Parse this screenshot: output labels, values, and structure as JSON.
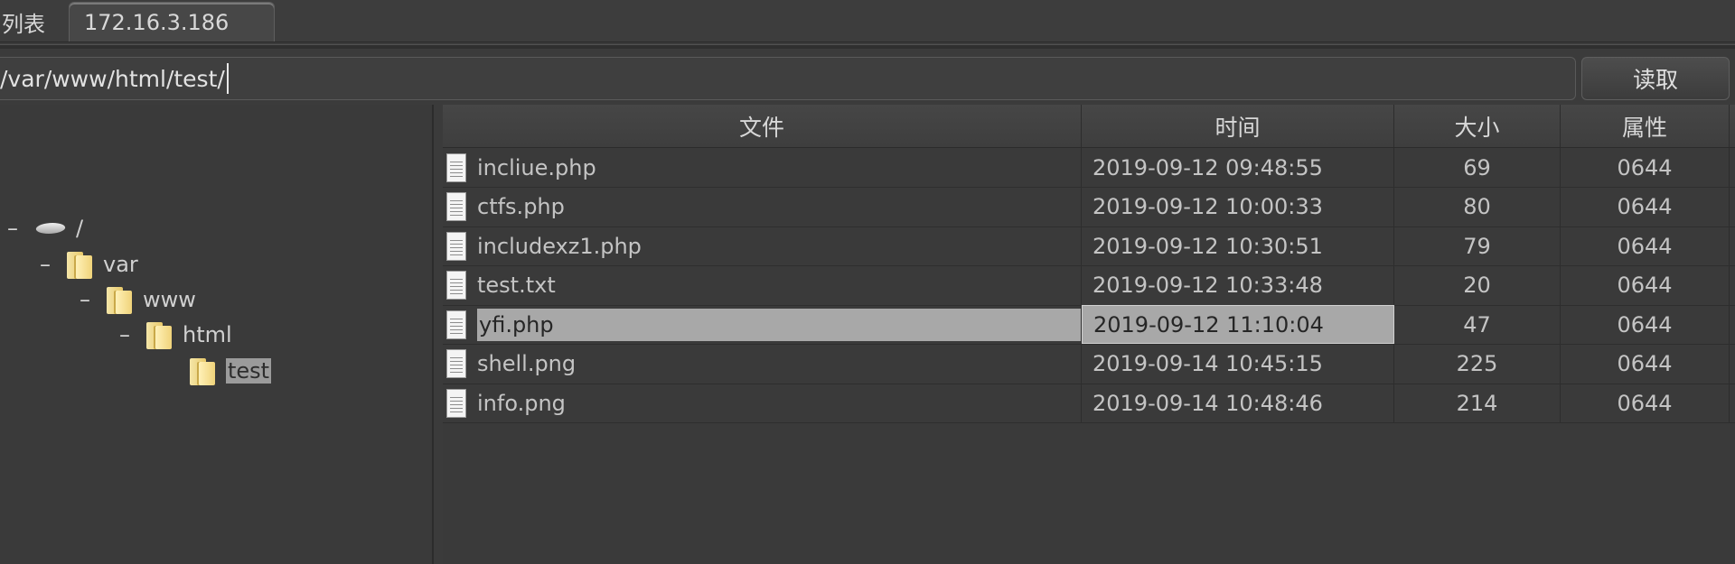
{
  "tabs": [
    {
      "label": "列表"
    },
    {
      "label": "172.16.3.186"
    }
  ],
  "path": {
    "value": "/var/www/html/test/"
  },
  "read_button": {
    "label": "读取"
  },
  "tree": {
    "nodes": [
      {
        "label": "/",
        "toggle": "–",
        "icon": "drive-icon"
      },
      {
        "label": "var",
        "toggle": "–",
        "icon": "folder-icon"
      },
      {
        "label": "www",
        "toggle": "–",
        "icon": "folder-icon"
      },
      {
        "label": "html",
        "toggle": "–",
        "icon": "folder-icon"
      },
      {
        "label": "test",
        "toggle": "",
        "icon": "folder-icon",
        "selected": true
      }
    ]
  },
  "table": {
    "headers": [
      "文件",
      "时间",
      "大小",
      "属性"
    ],
    "rows": [
      {
        "name": "incliue.php",
        "time": "2019-09-12 09:48:55",
        "size": "69",
        "attr": "0644"
      },
      {
        "name": "ctfs.php",
        "time": "2019-09-12 10:00:33",
        "size": "80",
        "attr": "0644"
      },
      {
        "name": "includexz1.php",
        "time": "2019-09-12 10:30:51",
        "size": "79",
        "attr": "0644"
      },
      {
        "name": "test.txt",
        "time": "2019-09-12 10:33:48",
        "size": "20",
        "attr": "0644"
      },
      {
        "name": "yfi.php",
        "time": "2019-09-12 11:10:04",
        "size": "47",
        "attr": "0644",
        "selected": true
      },
      {
        "name": "shell.png",
        "time": "2019-09-14 10:45:15",
        "size": "225",
        "attr": "0644"
      },
      {
        "name": "info.png",
        "time": "2019-09-14 10:48:46",
        "size": "214",
        "attr": "0644"
      }
    ]
  },
  "colors": {
    "background": "#3b3b3b",
    "selection": "#a8a8a8",
    "text": "#c4c4c4"
  }
}
